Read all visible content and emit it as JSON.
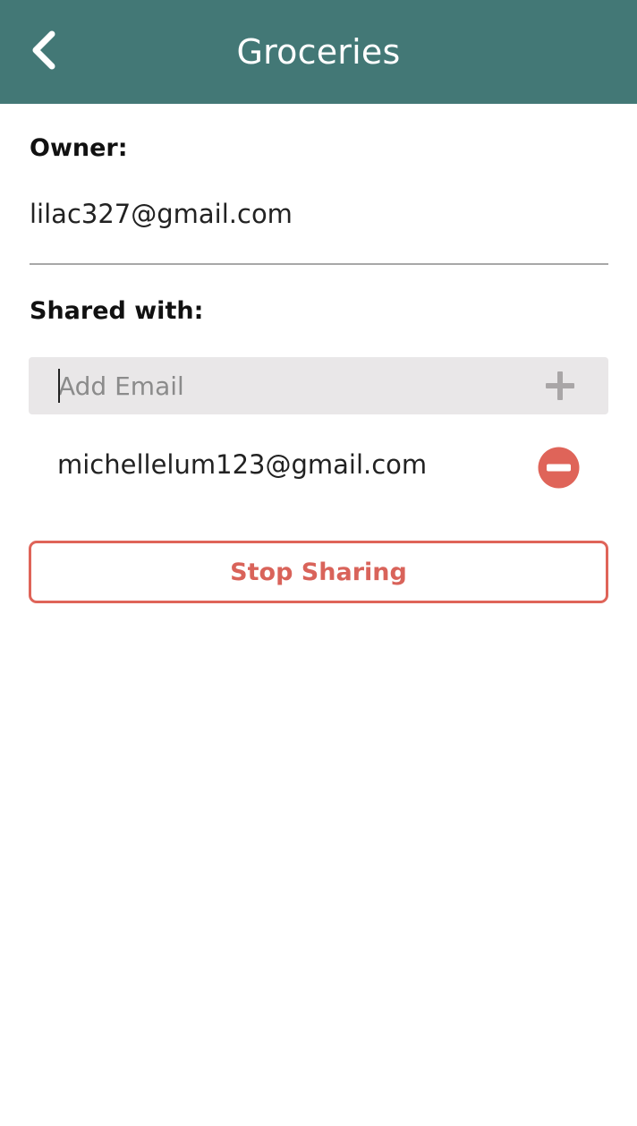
{
  "header": {
    "title": "Groceries",
    "back_icon": "chevron-left-icon",
    "background_color": "#437876"
  },
  "owner": {
    "label": "Owner:",
    "email": "lilac327@gmail.com"
  },
  "shared": {
    "label": "Shared with:",
    "add_email_placeholder": "Add Email",
    "add_email_value": "",
    "add_icon": "plus-icon",
    "members": [
      {
        "email": "michellelum123@gmail.com",
        "remove_icon": "minus-circle-icon"
      }
    ]
  },
  "actions": {
    "stop_sharing_label": "Stop Sharing",
    "accent_color": "#df6459"
  }
}
